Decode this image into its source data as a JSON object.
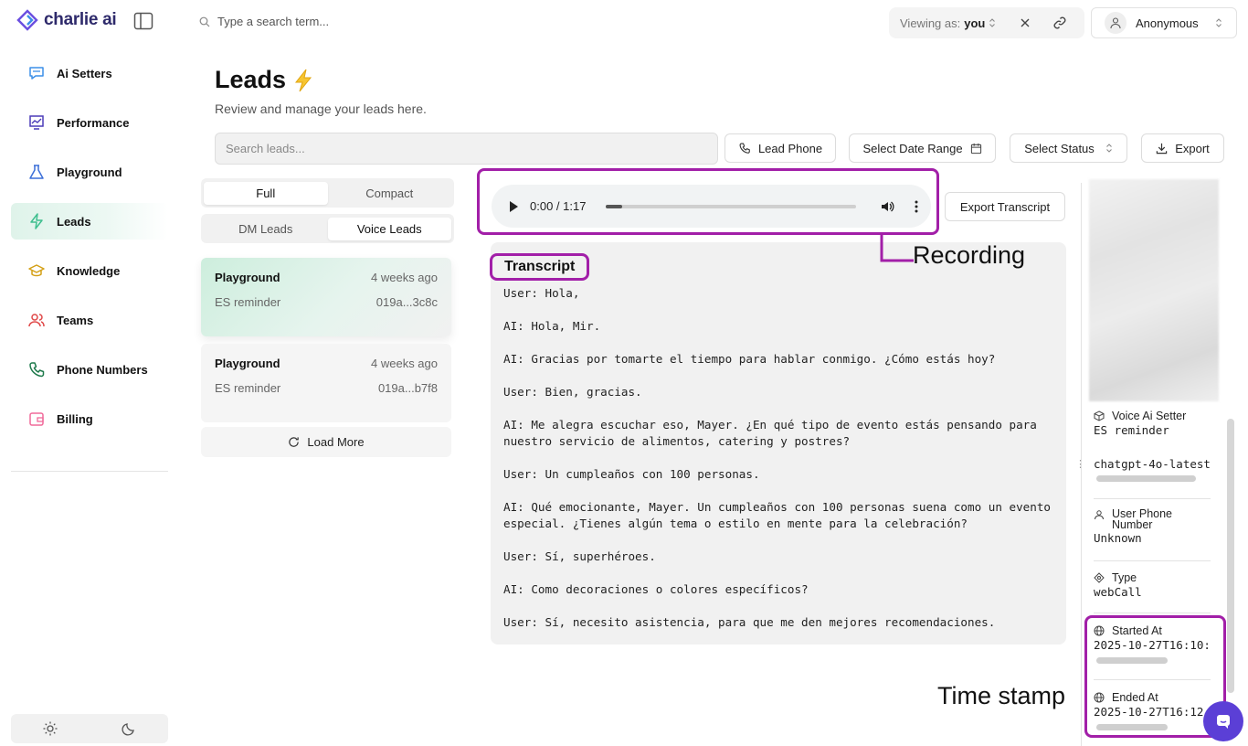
{
  "brand": {
    "name": "charlie ai"
  },
  "sidebar": {
    "items": [
      {
        "label": "Ai Setters",
        "icon": "chat-icon"
      },
      {
        "label": "Performance",
        "icon": "chart-icon"
      },
      {
        "label": "Playground",
        "icon": "flask-icon"
      },
      {
        "label": "Leads",
        "icon": "lightning-icon",
        "active": true
      },
      {
        "label": "Knowledge",
        "icon": "graduation-cap-icon"
      },
      {
        "label": "Teams",
        "icon": "users-icon"
      },
      {
        "label": "Phone Numbers",
        "icon": "phone-icon"
      },
      {
        "label": "Billing",
        "icon": "wallet-icon"
      }
    ]
  },
  "topbar": {
    "search_placeholder": "Type a search term...",
    "viewing_label": "Viewing as:",
    "viewing_value": "you",
    "user_name": "Anonymous"
  },
  "header": {
    "title": "Leads",
    "subtitle": "Review and manage your leads here."
  },
  "toolbar": {
    "search_placeholder": "Search leads...",
    "lead_phone": "Lead Phone",
    "date_range": "Select Date Range",
    "status": "Select Status",
    "export": "Export"
  },
  "views": {
    "full": "Full",
    "compact": "Compact"
  },
  "lead_types": {
    "dm": "DM Leads",
    "voice": "Voice Leads"
  },
  "leads": [
    {
      "name": "Playground",
      "time": "4 weeks ago",
      "setter": "ES reminder",
      "id": "019a...3c8c"
    },
    {
      "name": "Playground",
      "time": "4 weeks ago",
      "setter": "ES reminder",
      "id": "019a...b7f8"
    }
  ],
  "load_more": "Load More",
  "audio": {
    "time": "0:00 / 1:17",
    "progress": 0.0
  },
  "export_transcript": "Export Transcript",
  "transcript": {
    "title": "Transcript",
    "lines": [
      "User: Hola,",
      "AI: Hola, Mir.",
      "AI: Gracias por tomarte el tiempo para hablar conmigo. ¿Cómo estás hoy?",
      "User: Bien, gracias.",
      "AI: Me alegra escuchar eso, Mayer. ¿En qué tipo de evento estás pensando para nuestro servicio de alimentos, catering y postres?",
      "User: Un cumpleaños con 100 personas.",
      "AI: Qué emocionante, Mayer. Un cumpleaños con 100 personas suena como un evento especial. ¿Tienes algún tema o estilo en mente para la celebración?",
      "User: Sí, superhéroes.",
      "AI: Como decoraciones o colores específicos?",
      "User: Sí, necesito asistencia, para que me den mejores recomendaciones."
    ]
  },
  "annotations": {
    "recording": "Recording",
    "timestamp": "Time stamp"
  },
  "details": {
    "setter_label": "Voice Ai Setter",
    "setter_value": "ES reminder",
    "model": "chatgpt-4o-latest",
    "phone_label": "User Phone Number",
    "phone_value": "Unknown",
    "type_label": "Type",
    "type_value": "webCall",
    "started_label": "Started At",
    "started_value": "2025-10-27T16:10:",
    "ended_label": "Ended At",
    "ended_value": "2025-10-27T16:12"
  },
  "colors": {
    "accent": "#a21fa8",
    "active_nav": "#dff3ea",
    "brand": "#2e2a6b"
  }
}
